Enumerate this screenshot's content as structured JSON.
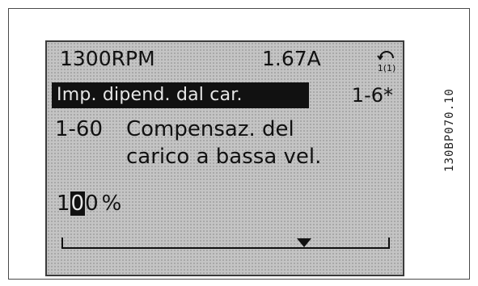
{
  "display": {
    "status": {
      "speed": "1300RPM",
      "current": "1.67A",
      "menu_icon": "quick-menu-icon",
      "menu_icon_number": "1(1)"
    },
    "group": {
      "title": "Imp. dipend. dal car.",
      "code": "1-6*"
    },
    "parameter": {
      "number": "1-60",
      "name_line1": "Compensaz. del",
      "name_line2": "carico a bassa vel."
    },
    "value": {
      "prefix": "1",
      "cursor_digit": "0",
      "suffix": "0",
      "unit": "%"
    },
    "slider": {
      "marker_position_fraction": 0.74
    }
  },
  "figure_code": "130BP070.10",
  "colors": {
    "lcd_background": "#c4c4c4",
    "lcd_text": "#111111",
    "highlight_text": "#e6e6e6"
  }
}
